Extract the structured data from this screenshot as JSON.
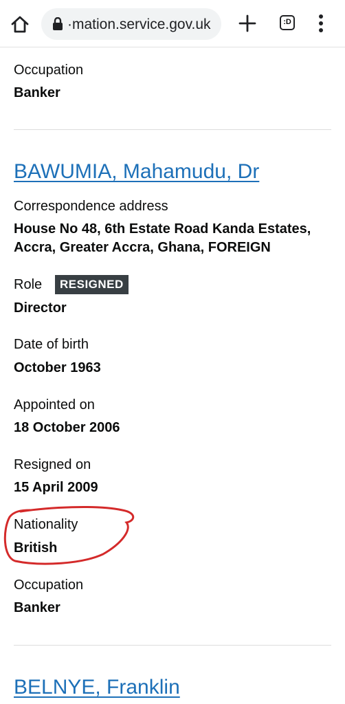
{
  "browser": {
    "url": "·mation.service.gov.uk",
    "tab_count_label": ":D"
  },
  "top_section": {
    "occupation_label": "Occupation",
    "occupation_value": "Banker"
  },
  "officer": {
    "name": "BAWUMIA, Mahamudu, Dr",
    "address_label": "Correspondence address",
    "address_line1": "House No 48, 6th Estate Road Kanda Estates,",
    "address_line2": "Accra, Greater Accra, Ghana, FOREIGN",
    "role_label": "Role",
    "role_status": "RESIGNED",
    "role_value": "Director",
    "dob_label": "Date of birth",
    "dob_value": "October 1963",
    "appointed_label": "Appointed on",
    "appointed_value": "18 October 2006",
    "resigned_label": "Resigned on",
    "resigned_value": "15 April 2009",
    "nationality_label": "Nationality",
    "nationality_value": "British",
    "occupation_label": "Occupation",
    "occupation_value": "Banker"
  },
  "next_officer": {
    "name": "BELNYE, Franklin"
  },
  "colors": {
    "link": "#1d70b8",
    "tag_bg": "#383f43",
    "annotation": "#d42a2a"
  },
  "icons": [
    "home-icon",
    "lock-icon",
    "new-tab-icon",
    "tab-switcher-icon",
    "more-menu-icon"
  ]
}
